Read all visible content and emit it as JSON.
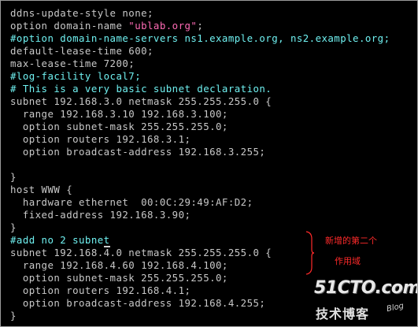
{
  "terminal": {
    "lines": [
      {
        "segments": [
          {
            "text": "ddns-update-style none;",
            "kind": "plain"
          }
        ]
      },
      {
        "segments": [
          {
            "text": "option domain-name ",
            "kind": "plain"
          },
          {
            "text": "\"ublab.org\"",
            "kind": "str"
          },
          {
            "text": ";",
            "kind": "plain"
          }
        ]
      },
      {
        "segments": [
          {
            "text": "#option domain-name-servers ns1.example.org, ns2.example.org;",
            "kind": "comment"
          }
        ]
      },
      {
        "segments": [
          {
            "text": "default-lease-time 600;",
            "kind": "plain"
          }
        ]
      },
      {
        "segments": [
          {
            "text": "max-lease-time 7200;",
            "kind": "plain"
          }
        ]
      },
      {
        "segments": [
          {
            "text": "#log-facility local7;",
            "kind": "comment"
          }
        ]
      },
      {
        "segments": [
          {
            "text": "# This is a very basic subnet declaration.",
            "kind": "comment"
          }
        ]
      },
      {
        "segments": [
          {
            "text": "subnet 192.168.3.0 netmask 255.255.255.0 {",
            "kind": "plain"
          }
        ]
      },
      {
        "segments": [
          {
            "text": "  range 192.168.3.10 192.168.3.100;",
            "kind": "plain"
          }
        ]
      },
      {
        "segments": [
          {
            "text": "  option subnet-mask 255.255.255.0;",
            "kind": "plain"
          }
        ]
      },
      {
        "segments": [
          {
            "text": "  option routers 192.168.3.1;",
            "kind": "plain"
          }
        ]
      },
      {
        "segments": [
          {
            "text": "  option broadcast-address 192.168.3.255;",
            "kind": "plain"
          }
        ]
      },
      {
        "segments": [
          {
            "text": "",
            "kind": "plain"
          }
        ]
      },
      {
        "segments": [
          {
            "text": "}",
            "kind": "plain"
          }
        ]
      },
      {
        "segments": [
          {
            "text": "host WWW {",
            "kind": "plain"
          }
        ]
      },
      {
        "segments": [
          {
            "text": "  hardware ethernet  00:0C:29:49:AF:D2;",
            "kind": "plain"
          }
        ]
      },
      {
        "segments": [
          {
            "text": "  fixed-address 192.168.3.90;",
            "kind": "plain"
          }
        ]
      },
      {
        "segments": [
          {
            "text": "}",
            "kind": "plain"
          }
        ]
      },
      {
        "segments": [
          {
            "text": "#add no 2 subne",
            "kind": "comment"
          },
          {
            "text": "t",
            "kind": "comment-cursor"
          }
        ]
      },
      {
        "segments": [
          {
            "text": "subnet 192.168.4.0 netmask 255.255.255.0 {",
            "kind": "plain"
          }
        ]
      },
      {
        "segments": [
          {
            "text": "  range 192.168.4.60 192.168.4.100;",
            "kind": "plain"
          }
        ]
      },
      {
        "segments": [
          {
            "text": "  option subnet-mask 255.255.255.0;",
            "kind": "plain"
          }
        ]
      },
      {
        "segments": [
          {
            "text": "  option routers 192.168.4.1;",
            "kind": "plain"
          }
        ]
      },
      {
        "segments": [
          {
            "text": "  option broadcast-address 192.168.4.255;",
            "kind": "plain"
          }
        ]
      },
      {
        "segments": [
          {
            "text": "}",
            "kind": "plain"
          }
        ]
      }
    ]
  },
  "annotation": {
    "line1": "新增的第二个",
    "line2": "作用域",
    "color": "#ff2a2a"
  },
  "watermark": {
    "logo": "51CTO.com",
    "subtitle": "技术博客",
    "tag": "Blog"
  },
  "colors": {
    "background": "#000000",
    "text": "#c8c8c8",
    "comment": "#6ff0f0",
    "string": "#ff6bb5"
  }
}
